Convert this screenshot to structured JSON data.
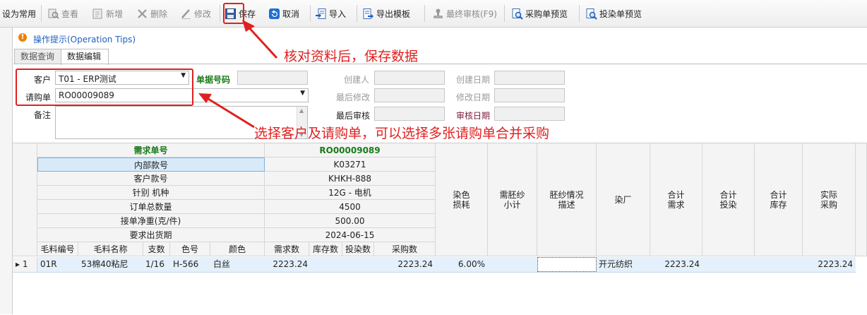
{
  "toolbar": {
    "set_common": "设为常用",
    "view": "查看",
    "add": "新增",
    "delete": "删除",
    "modify": "修改",
    "save": "保存",
    "cancel": "取消",
    "import": "导入",
    "export_template": "导出模板",
    "final_review": "最终审核(F9)",
    "purchase_preview": "采购单预览",
    "dye_preview": "投染单预览"
  },
  "tips": {
    "label": "操作提示(Operation Tips)"
  },
  "tabs": [
    "数据查询",
    "数据编辑"
  ],
  "form": {
    "customer_label": "客户",
    "customer_value": "T01 - ERP测试",
    "doc_no_label": "单据号码",
    "creator_label": "创建人",
    "create_date_label": "创建日期",
    "request_label": "请购单",
    "request_value": "RO00009089",
    "last_modify_label": "最后修改",
    "modify_date_label": "修改日期",
    "remark_label": "备注",
    "last_review_label": "最后审核",
    "review_date_label": "审核日期"
  },
  "annotations": {
    "save_note": "核对资料后，保存数据",
    "select_note": "选择客户及请购单，可以选择多张请购单合并采购"
  },
  "grid": {
    "info_labels": [
      "需求单号",
      "内部款号",
      "客户款号",
      "针别 机种",
      "订单总数量",
      "接单净重(克/件)",
      "要求出货期"
    ],
    "info_values": [
      "RO00009089",
      "K03271",
      "KHKH-888",
      "12G - 电机",
      "4500",
      "500.00",
      "2024-06-15"
    ],
    "sub_headers": [
      "毛料编号",
      "毛料名称",
      "支数",
      "色号",
      "颜色",
      "需求数",
      "库存数",
      "投染数",
      "采购数"
    ],
    "right_headers": [
      "染色\n损耗",
      "需胚纱\n小计",
      "胚纱情况\n描述",
      "染厂",
      "合计\n需求",
      "合计\n投染",
      "合计\n库存",
      "实际\n采购"
    ],
    "row": {
      "indicator": "▸ 1",
      "code": "01R",
      "name": "53棉40粘尼",
      "count": "1/16",
      "color_no": "H-566",
      "color": "白丝",
      "demand": "2223.24",
      "stock": "",
      "dye": "",
      "purchase": "2223.24",
      "loss": "6.00%",
      "greige_subtotal": "",
      "greige_desc": "",
      "dye_factory": "开元纺织",
      "total_demand": "2223.24",
      "total_dye": "",
      "total_stock": "",
      "actual_purchase": "2223.24"
    }
  },
  "colors": {
    "annotation": "#e02020",
    "green_header": "#1a7a1a",
    "tips_icon": "#f08000",
    "tips_text": "#1f5fbf"
  }
}
